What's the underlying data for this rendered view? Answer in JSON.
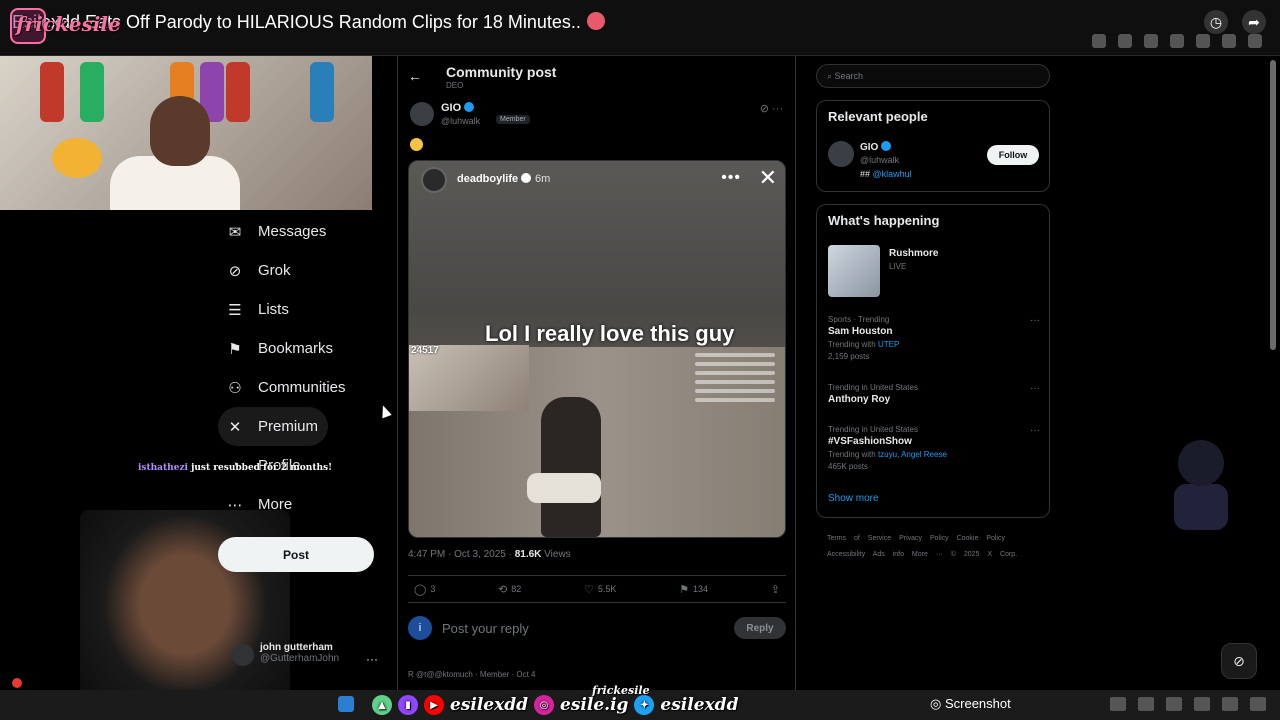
{
  "youtube": {
    "video_title": "Esilexdd Eats Off Parody to HILARIOUS Random Clips for 18 Minutes..",
    "overlay_name": "frickesile"
  },
  "nav": {
    "items": [
      {
        "icon": "mail-icon",
        "glyph": "✉",
        "label": "Messages"
      },
      {
        "icon": "grok-icon",
        "glyph": "⊘",
        "label": "Grok"
      },
      {
        "icon": "lists-icon",
        "glyph": "☰",
        "label": "Lists"
      },
      {
        "icon": "bookmark-icon",
        "glyph": "⚑",
        "label": "Bookmarks"
      },
      {
        "icon": "communities-icon",
        "glyph": "⚇",
        "label": "Communities"
      },
      {
        "icon": "x-icon",
        "glyph": "✕",
        "label": "Premium"
      },
      {
        "icon": "profile-icon",
        "glyph": "◔",
        "label": "Profile"
      },
      {
        "icon": "more-icon",
        "glyph": "⋯",
        "label": "More"
      }
    ],
    "post_button": "Post",
    "account": {
      "name": "john gutterham",
      "handle": "@GutterhamJohn",
      "more": "···"
    }
  },
  "sub_alert": {
    "user": "isthathezi",
    "text": "just resubbed for 2 months!"
  },
  "post": {
    "header_title": "Community post",
    "header_sub": "DEO",
    "author_name": "GIO",
    "author_handle": "@luhwalk",
    "member_badge": "Member",
    "media": {
      "username": "deadboylife",
      "time": "6m",
      "caption": "Lol I really love this guy",
      "counter": "24517"
    },
    "timestamp": "4:47 PM · Oct 3, 2025 · ",
    "views": "81.6K",
    "views_label": " Views",
    "actions": {
      "replies": "3",
      "reposts": "82",
      "likes": "5.5K",
      "bookmarks": "134"
    },
    "reply_avatar_letter": "i",
    "reply_placeholder": "Post your reply",
    "reply_button": "Reply",
    "next_post_preview": "R @t@@ktomuch · Member · Oct 4"
  },
  "right": {
    "search_placeholder": "Search",
    "relevant_title": "Relevant people",
    "relevant_person": {
      "name": "GIO",
      "handle": "@luhwalk",
      "bio_prefix": "## ",
      "bio_link": "@klawhul",
      "follow": "Follow"
    },
    "happening_title": "What's happening",
    "live": {
      "name": "Rushmore",
      "tag": "LIVE"
    },
    "trends": [
      {
        "category": "Sports · Trending",
        "name": "Sam Houston",
        "with_label": "Trending with ",
        "with_link": "UTEP",
        "count": "2,159 posts"
      },
      {
        "category": "Trending in United States",
        "name": "Anthony Roy",
        "with_label": "",
        "with_link": "",
        "count": ""
      },
      {
        "category": "Trending in United States",
        "name": "#VSFashionShow",
        "with_label": "Trending with ",
        "with_link": "tzuyu, Angel Reese",
        "count": "465K posts"
      }
    ],
    "show_more": "Show more",
    "footer": "Terms of Service   Privacy Policy   Cookie Policy   Accessibility   Ads info   More ···   © 2025 X Corp."
  },
  "stream": {
    "socials": [
      {
        "icon": "twitch-icon",
        "color": "#9146ff"
      },
      {
        "icon": "youtube-icon",
        "color": "#ff0000",
        "handle": "esilexdd"
      },
      {
        "icon": "instagram-icon",
        "color": "#d6249f",
        "handle": "esile.ig"
      },
      {
        "icon": "twitter-icon",
        "color": "#1da1f2",
        "handle": "esilexdd"
      }
    ],
    "top_handle": "frickesile",
    "taskbar_app": "Screenshot"
  }
}
